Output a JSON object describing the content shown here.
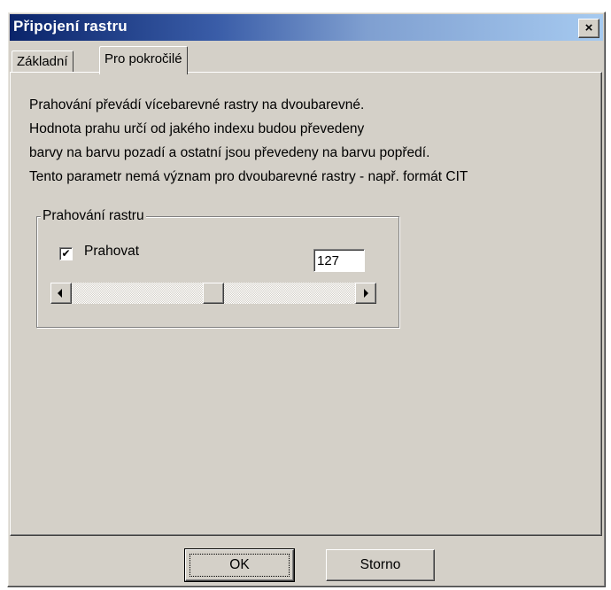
{
  "window": {
    "title": "Připojení rastru",
    "close_label": "×"
  },
  "tabs": [
    {
      "label": "Základní",
      "active": false
    },
    {
      "label": "Pro pokročilé",
      "active": true
    }
  ],
  "description": [
    "Prahování převádí vícebarevné rastry na dvoubarevné.",
    "Hodnota prahu určí od jakého indexu budou převedeny",
    "barvy na barvu pozadí a ostatní jsou převedeny na barvu popředí.",
    "Tento parametr nemá význam pro dvoubarevné rastry - např. formát CIT"
  ],
  "threshold_group": {
    "label": "Prahování rastru",
    "checkbox_label": "Prahovat",
    "checked": true,
    "check_mark": "✔",
    "value": "127",
    "slider_level": 0.5
  },
  "buttons": {
    "ok": "OK",
    "cancel": "Storno"
  },
  "colors": {
    "title_bar_start": "#0a246a",
    "title_bar_end": "#a6caf0",
    "dialog_face": "#d4d0c8"
  }
}
